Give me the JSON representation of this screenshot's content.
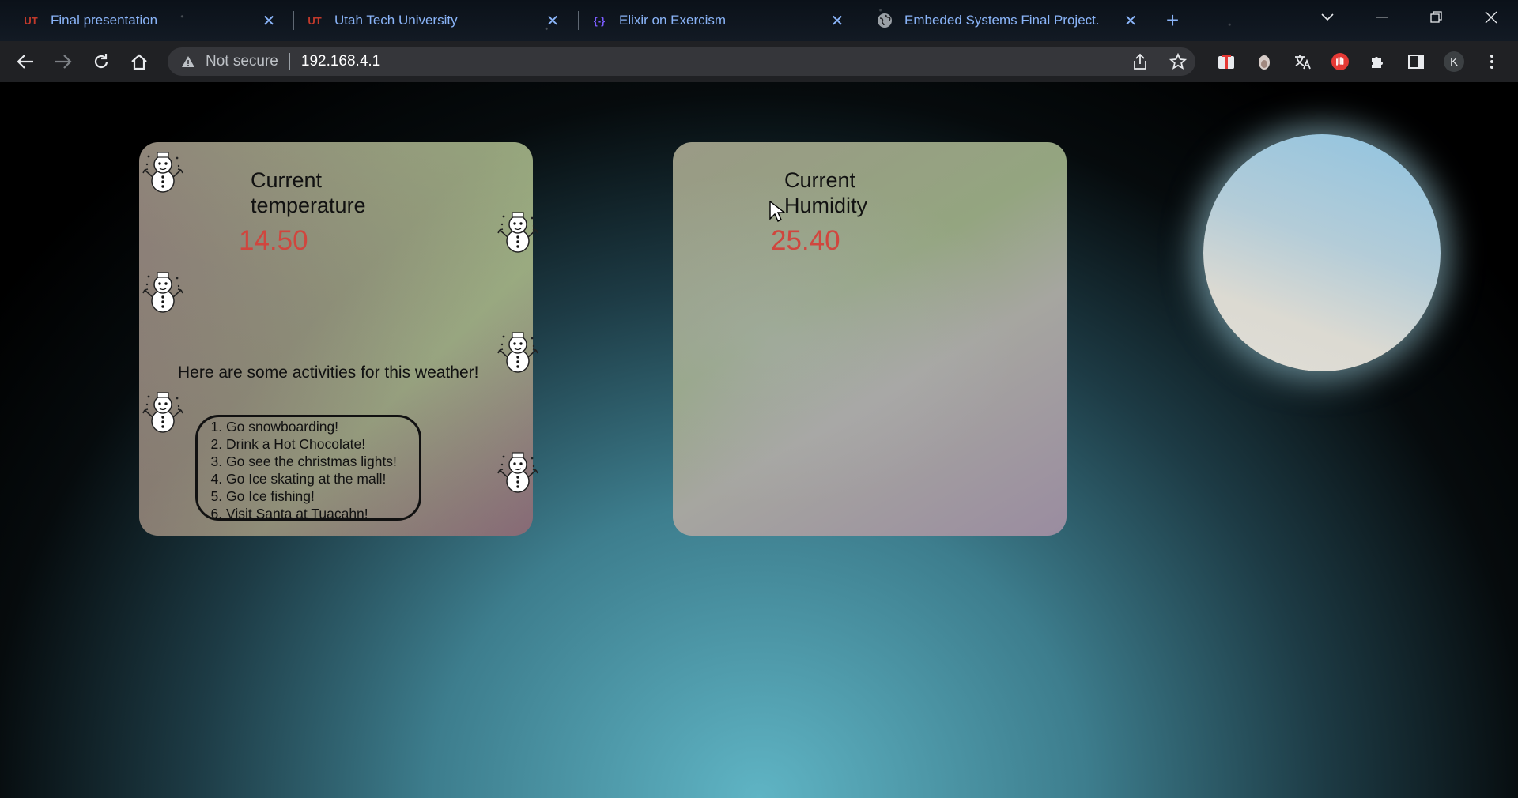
{
  "browser": {
    "tabs": [
      {
        "title": "Final presentation",
        "favicon": "UT"
      },
      {
        "title": "Utah Tech University",
        "favicon": "UT"
      },
      {
        "title": "Elixir on Exercism",
        "favicon": "{-}"
      },
      {
        "title": "Embeded Systems Final Project.",
        "favicon": "globe-icon"
      }
    ],
    "security_label": "Not secure",
    "url": "192.168.4.1",
    "profile_initial": "K"
  },
  "page": {
    "temperature": {
      "heading": "Current temperature",
      "value": "14.50",
      "activities_heading": "Here are some activities for this weather!",
      "activities": [
        "Go snowboarding!",
        "Drink a Hot Chocolate!",
        "Go see the christmas lights!",
        "Go Ice skating at the mall!",
        "Go Ice fishing!",
        "Visit Santa at Tuacahn!"
      ]
    },
    "humidity": {
      "heading": "Current Humidity",
      "value": "25.40"
    }
  },
  "colors": {
    "value_red": "#d0463e",
    "link_blue": "#8ab4f8"
  }
}
